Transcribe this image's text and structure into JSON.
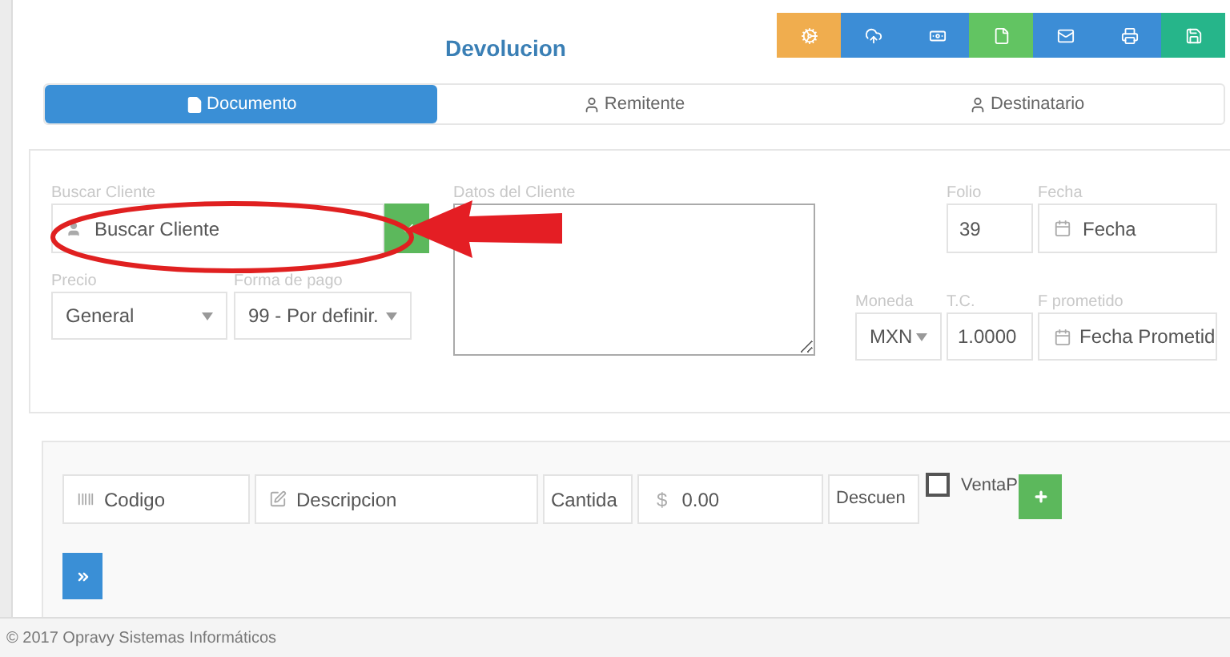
{
  "title": "Devolucion",
  "toolbar": [
    {
      "color": "#f0ad4e"
    },
    {
      "color": "#3c8dd6"
    },
    {
      "color": "#3c8dd6"
    },
    {
      "color": "#62c462"
    },
    {
      "color": "#3c8dd6"
    },
    {
      "color": "#3c8dd6"
    },
    {
      "color": "#26b58a"
    }
  ],
  "tabs": [
    {
      "label": "Documento",
      "selected": true
    },
    {
      "label": "Remitente",
      "selected": false
    },
    {
      "label": "Destinatario",
      "selected": false
    }
  ],
  "cliente": {
    "label": "Buscar Cliente",
    "placeholder": "Buscar Cliente"
  },
  "datos_cliente": {
    "label": "Datos del Cliente"
  },
  "folio": {
    "label": "Folio",
    "value": "39"
  },
  "fecha": {
    "label": "Fecha",
    "placeholder": "Fecha"
  },
  "precio": {
    "label": "Precio",
    "value": "General"
  },
  "forma_pago": {
    "label": "Forma de pago",
    "value": "99 - Por definir."
  },
  "moneda": {
    "label": "Moneda",
    "value": "MXN"
  },
  "tc": {
    "label": "T.C.",
    "value": "1.0000"
  },
  "f_prometido": {
    "label": "F prometido",
    "placeholder": "Fecha Prometid"
  },
  "item": {
    "codigo": {
      "placeholder": "Codigo"
    },
    "descripcion": {
      "placeholder": "Descripcion"
    },
    "cantidad": {
      "placeholder": "Cantida"
    },
    "precio_symbol": "$",
    "precio": {
      "placeholder": "0.00"
    },
    "descuento": {
      "placeholder": "Descuen"
    }
  },
  "venta": {
    "label": "VentaP",
    "checked": false
  },
  "footer": "© 2017 Opravy Sistemas Informáticos"
}
